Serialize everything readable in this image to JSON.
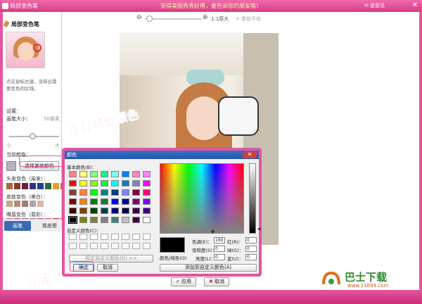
{
  "titlebar": {
    "title": "局部变色笔",
    "center": "觉得美图秀秀好用，要告诉您的朋友哦！",
    "feedback": "提意见",
    "close": "✕"
  },
  "toolbar": {
    "zoom_original": "1:1原大",
    "reset": "重新开始"
  },
  "sidebar": {
    "title": "局部变色笔",
    "description": "点击鼠标左键，涂抹出需要变色的区域。",
    "settings_label": "设置：",
    "brush_size_label": "画笔大小：",
    "brush_size_value": "50像素",
    "size_small": "小",
    "size_large": "大",
    "current_color_label": "当前颜色：",
    "other_color_button": "选择其他颜色",
    "hair_label": "头发变色（染发）：",
    "skin_label": "皮肤变色（美白）：",
    "lip_label": "嘴唇变色（唇彩）：",
    "hair_colors": [
      "#a66b2f",
      "#8a3a2a",
      "#6b1f3c",
      "#3a2f80",
      "#1f3f9a",
      "#2c6a3a",
      "#d9a436",
      "#c7642e"
    ],
    "skin_colors": [
      "#c9a58a",
      "#b48a72",
      "#9e7d78",
      "#b4a3a8",
      "#d4b9a7"
    ],
    "lip_colors": [
      "#c96a9a",
      "#b04a7a",
      "#9a6ab0",
      "#a080c0",
      "#c050a0",
      "#e07070",
      "#d03050",
      "#c04040"
    ],
    "tab_brush": "画笔",
    "tab_eraser": "橡皮擦"
  },
  "dialog": {
    "title": "颜色",
    "basic_colors_label": "基本颜色(B)：",
    "custom_colors_label": "自定义颜色(C)：",
    "define_custom": "规定自定义颜色(D) >>",
    "ok": "确定",
    "cancel": "取消",
    "color_solid": "颜色|纯色(O)",
    "hue_label": "色调(E)：",
    "sat_label": "饱和度(S)：",
    "lum_label": "亮度(L)：",
    "red_label": "红(R)：",
    "green_label": "绿(G)：",
    "blue_label": "蓝(U)：",
    "hue": "160",
    "sat": "0",
    "lum": "0",
    "red": "0",
    "green": "0",
    "blue": "0",
    "add_custom": "添加到自定义颜色(A)",
    "basic_colors": [
      "#ff8080",
      "#ffff80",
      "#80ff80",
      "#00ff80",
      "#80ffff",
      "#0080ff",
      "#ff80c0",
      "#ff80ff",
      "#ff0000",
      "#ffff00",
      "#80ff00",
      "#00ff40",
      "#00ffff",
      "#0080c0",
      "#8080c0",
      "#ff00ff",
      "#804040",
      "#ff8040",
      "#00ff00",
      "#008080",
      "#004080",
      "#8080ff",
      "#800040",
      "#ff0080",
      "#800000",
      "#ff8000",
      "#008000",
      "#008040",
      "#0000ff",
      "#0000a0",
      "#800080",
      "#8000ff",
      "#400000",
      "#804000",
      "#004000",
      "#004040",
      "#000080",
      "#000040",
      "#400040",
      "#400080",
      "#000000",
      "#808000",
      "#808040",
      "#808080",
      "#408080",
      "#c0c0c0",
      "#400040",
      "#ffffff"
    ]
  },
  "annotations": {
    "choose_other": "选择其他颜色",
    "confirm": "确定"
  },
  "footer": {
    "apply": "应用",
    "cancel": "取消"
  },
  "watermark": {
    "brand": "巴士下载",
    "url": "www.11684.com"
  }
}
